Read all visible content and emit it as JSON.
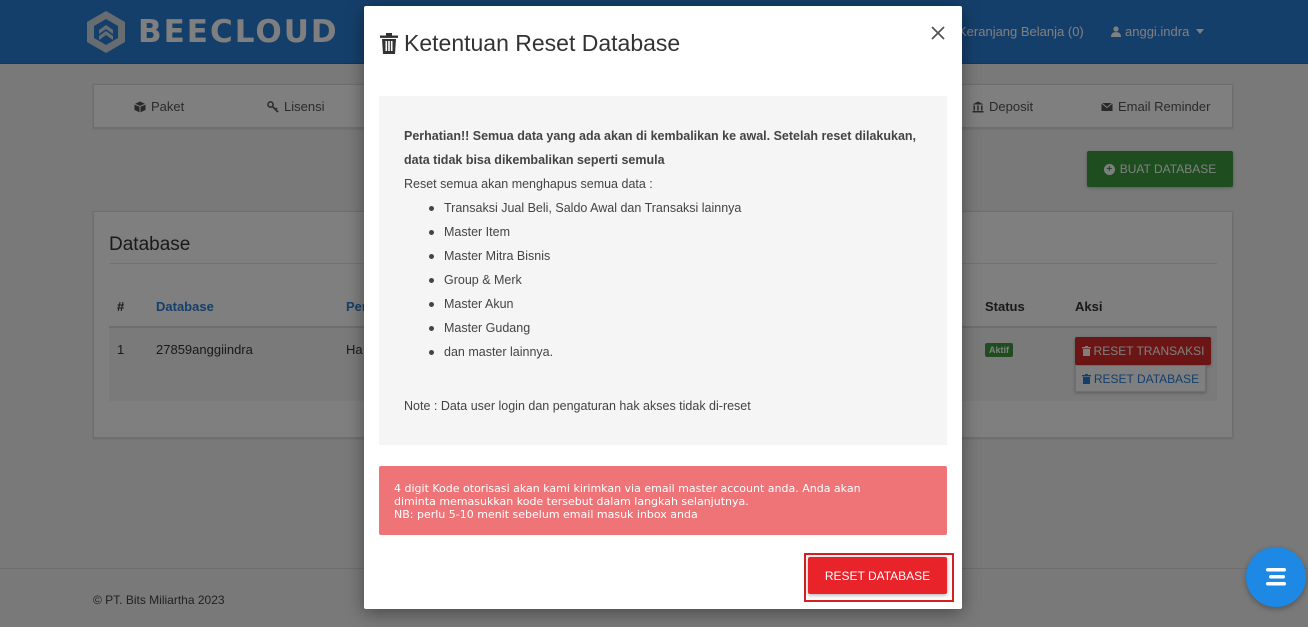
{
  "app": {
    "brand": "BEECLOUD",
    "cart_label": "Keranjang Belanja (0)",
    "user_label": "anggi.indra"
  },
  "nav": {
    "items": [
      {
        "label": "Paket",
        "icon": "cube-icon"
      },
      {
        "label": "Lisensi",
        "icon": "key-icon"
      },
      {
        "label": "Deposit",
        "icon": "bank-icon"
      },
      {
        "label": "Email Reminder",
        "icon": "envelope-icon"
      }
    ]
  },
  "actions": {
    "create_db_label": "BUAT DATABASE"
  },
  "panel": {
    "title": "Database",
    "columns": [
      "#",
      "Database",
      "Per",
      "Status",
      "Aksi"
    ],
    "rows": [
      {
        "no": "1",
        "database": "27859anggiindra",
        "per": "Ha",
        "status": "Aktif"
      }
    ],
    "btn_reset_transaksi": "RESET TRANSAKSI",
    "btn_reset_database": "RESET DATABASE"
  },
  "footer": {
    "copyright": "© PT. Bits Miliartha 2023"
  },
  "modal": {
    "title": "Ketentuan Reset Database",
    "warning_line1": "Perhatian!! Semua data yang ada akan di kembalikan ke awal. Setelah reset dilakukan,",
    "warning_line2": "data tidak bisa dikembalikan seperti semula",
    "intro": "Reset semua akan menghapus semua data :",
    "list": [
      "Transaksi Jual Beli, Saldo Awal dan Transaksi lainnya",
      "Master Item",
      "Master Mitra Bisnis",
      "Group & Merk",
      "Master Akun",
      "Master Gudang",
      "dan master lainnya."
    ],
    "note": "Note : Data user login dan pengaturan hak akses tidak di-reset",
    "alert_line1": "4 digit Kode otorisasi akan kami kirimkan via email master account anda. Anda akan",
    "alert_line2": "diminta memasukkan kode tersebut dalam langkah selanjutnya.",
    "alert_line3": "NB: perlu 5-10 menit sebelum email masuk inbox anda",
    "reset_button": "RESET DATABASE"
  },
  "colors": {
    "topbar": "#2a7fd6",
    "success": "#3c9d3e",
    "danger": "#e8232a",
    "alert_bg": "#ef7478"
  }
}
